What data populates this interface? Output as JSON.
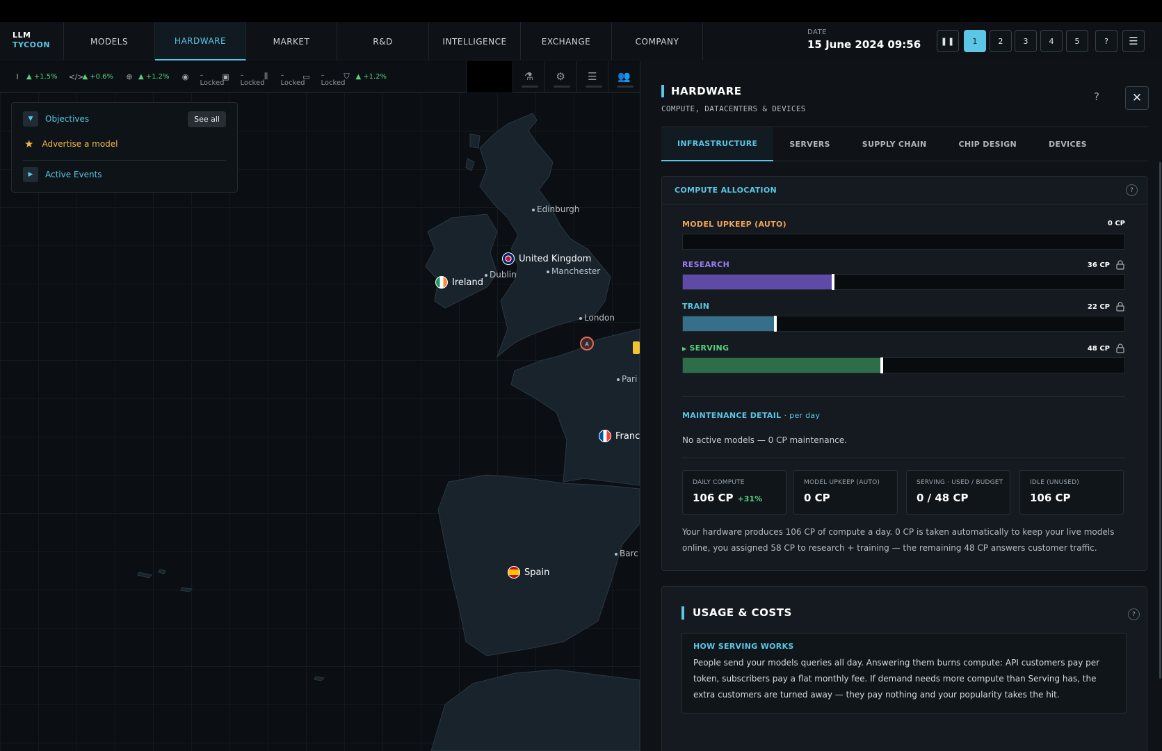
{
  "app": {
    "logo_line1": "LLM",
    "logo_line2": "TYCOON"
  },
  "nav": {
    "tabs": [
      "MODELS",
      "HARDWARE",
      "MARKET",
      "R&D",
      "INTELLIGENCE",
      "EXCHANGE",
      "COMPANY"
    ],
    "active": "HARDWARE"
  },
  "date": {
    "label": "DATE",
    "value": "15 June 2024  09:56"
  },
  "controls": {
    "pause_icon": "pause-icon",
    "speeds": [
      "1",
      "2",
      "3",
      "4",
      "5"
    ],
    "selected_speed": "1",
    "help": "?",
    "menu_icon": "menu-icon"
  },
  "stats": [
    {
      "icon": "text-cursor-icon",
      "value": "+1.5%",
      "state": "up"
    },
    {
      "icon": "code-icon",
      "value": "+0.6%",
      "state": "up"
    },
    {
      "icon": "globe-icon",
      "value": "+1.2%",
      "state": "up"
    },
    {
      "icon": "eye-icon",
      "value": "– Locked",
      "state": "locked"
    },
    {
      "icon": "image-icon",
      "value": "– Locked",
      "state": "locked"
    },
    {
      "icon": "audio-icon",
      "value": "– Locked",
      "state": "locked"
    },
    {
      "icon": "video-icon",
      "value": "– Locked",
      "state": "locked"
    },
    {
      "icon": "shield-icon",
      "value": "+1.2%",
      "state": "up"
    }
  ],
  "toolbox": [
    "flask-icon",
    "gear-icon",
    "sliders-icon",
    "people-icon"
  ],
  "objectives": {
    "title": "Objectives",
    "see_all": "See all",
    "items": [
      "Advertise a model"
    ],
    "events_title": "Active Events"
  },
  "map": {
    "countries": [
      "United Kingdom",
      "Ireland",
      "Franc",
      "Spain"
    ],
    "cities": [
      "Edinburgh",
      "Dublin",
      "Manchester",
      "London",
      "Pari",
      "Barc"
    ],
    "marker_label": "A"
  },
  "panel": {
    "title": "HARDWARE",
    "subtitle": "COMPUTE, DATACENTERS & DEVICES",
    "help": "?",
    "tabs": [
      "INFRASTRUCTURE",
      "SERVERS",
      "SUPPLY CHAIN",
      "CHIP DESIGN",
      "DEVICES"
    ],
    "active_tab": "INFRASTRUCTURE"
  },
  "compute": {
    "title": "COMPUTE ALLOCATION",
    "help": "?",
    "rows": [
      {
        "label": "MODEL UPKEEP (AUTO)",
        "value": "0 CP",
        "fraction": 0.0,
        "color": "#f0a35a",
        "fill": "#f0a35a",
        "locked": false
      },
      {
        "label": "RESEARCH",
        "value": "36 CP",
        "fraction": 0.34,
        "color": "#9a7ef0",
        "fill": "#5f4aa8",
        "locked": true
      },
      {
        "label": "TRAIN",
        "value": "22 CP",
        "fraction": 0.21,
        "color": "#5bc6e6",
        "fill": "#356f8a",
        "locked": true
      },
      {
        "label": "SERVING",
        "value": "48 CP",
        "fraction": 0.45,
        "color": "#57d27d",
        "fill": "#2d6e48",
        "locked": true
      }
    ],
    "maintenance_title": "MAINTENANCE DETAIL",
    "maintenance_per": "· per day",
    "maintenance_text": "No active models — 0 CP maintenance.",
    "stats": [
      {
        "label": "DAILY COMPUTE",
        "value": "106 CP",
        "change": "+31%"
      },
      {
        "label": "MODEL UPKEEP (AUTO)",
        "value": "0 CP",
        "change": ""
      },
      {
        "label": "SERVING · USED / BUDGET",
        "value": "0 / 48 CP",
        "change": ""
      },
      {
        "label": "IDLE (UNUSED)",
        "value": "106 CP",
        "change": ""
      }
    ],
    "description": "Your hardware produces 106 CP of compute a day. 0 CP is taken automatically to keep your live models online, you assigned 58 CP to research + training — the remaining 48 CP answers customer traffic."
  },
  "usage": {
    "title": "USAGE & COSTS",
    "help": "?",
    "how_title": "HOW SERVING WORKS",
    "how_text": "People send your models queries all day. Answering them burns compute: API customers pay per token, subscribers pay a flat monthly fee. If demand needs more compute than Serving has, the extra customers are turned away — they pay nothing and your popularity takes the hit."
  },
  "colors": {
    "accent": "#5bc6e6",
    "positive": "#57d27d",
    "objective": "#f0b94a"
  }
}
